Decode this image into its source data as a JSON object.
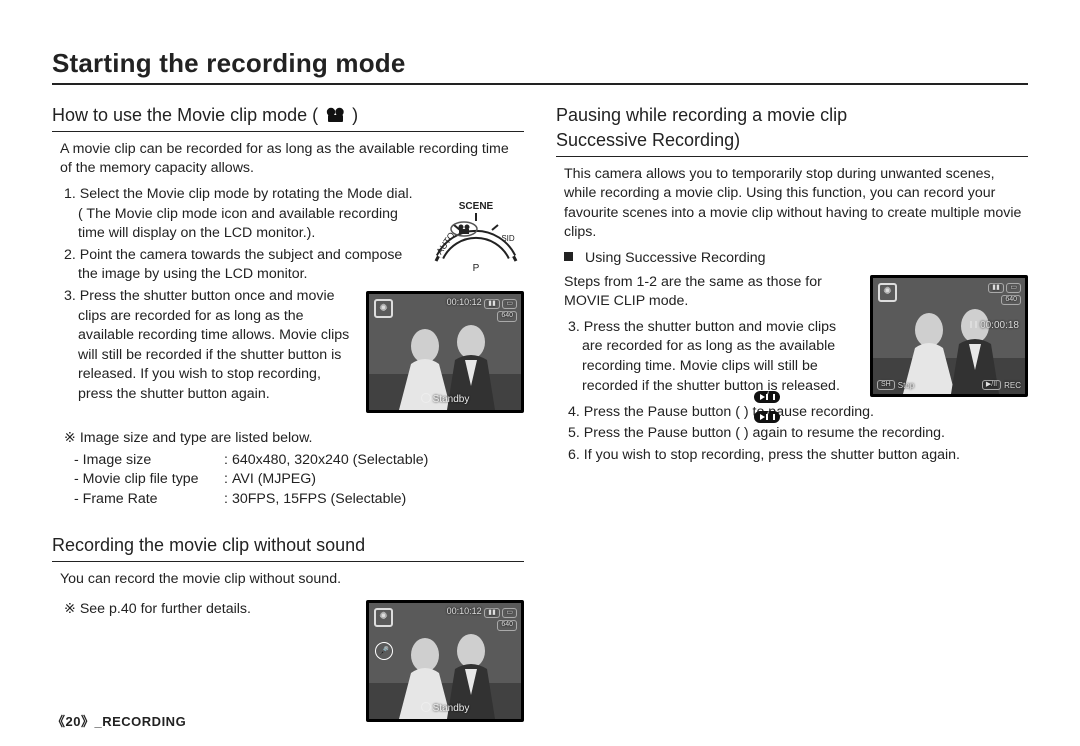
{
  "title": "Starting the recording mode",
  "left": {
    "sectionA": {
      "heading": "How to use the Movie clip mode (",
      "heading_close": ")",
      "lead": "A movie clip can be recorded for as long as the available recording time of the memory capacity allows.",
      "steps": [
        "1. Select the Movie clip mode by rotating the Mode dial. ( The Movie clip mode icon and available recording time will display on the LCD monitor.).",
        "2. Point the camera towards the subject and compose the image by using the LCD monitor.",
        "3. Press the shutter button once and movie clips are recorded for as long as the available recording time allows. Movie clips will still be recorded if the shutter button is released. If you wish to stop recording, press the shutter button again."
      ],
      "note_header": "※ Image size and type are listed below.",
      "specs": [
        {
          "label": "- Image size",
          "value": "640x480, 320x240 (Selectable)"
        },
        {
          "label": "- Movie clip file type",
          "value": "AVI (MJPEG)"
        },
        {
          "label": "- Frame Rate",
          "value": "30FPS, 15FPS (Selectable)"
        }
      ]
    },
    "sectionB": {
      "heading": "Recording the movie clip without sound",
      "lead": "You can record the movie clip without sound.",
      "note": "※ See p.40 for further details."
    }
  },
  "right": {
    "heading_l1": "Pausing while recording a movie clip",
    "heading_l2": "Successive Recording)",
    "lead": "This camera allows you to temporarily stop during unwanted scenes, while recording a movie clip. Using this function, you can record your favourite scenes into a movie clip without having to create multiple movie clips.",
    "bullet": "Using Successive Recording",
    "intro": "Steps from 1-2 are the same as those for MOVIE CLIP mode.",
    "steps": [
      "3. Press the shutter button and movie clips are recorded for as long as the available recording time. Movie clips will still be recorded if the shutter button is released.",
      "4. Press the Pause button (        ) to pause recording.",
      "5. Press the Pause button (        ) again to resume the recording.",
      "6. If you wish to stop recording, press the shutter button again."
    ]
  },
  "lcd": {
    "time_remaining": "00:10:12",
    "size_badge": "640",
    "standby": "Standby",
    "rec_time": "00:00:18",
    "stop": "Stop",
    "rec": "REC",
    "sh": "SH",
    "play_pause": "▶/II"
  },
  "footer": {
    "page_num": "20",
    "section": "_RECORDING",
    "bracket_open": "《",
    "bracket_close": "》"
  }
}
